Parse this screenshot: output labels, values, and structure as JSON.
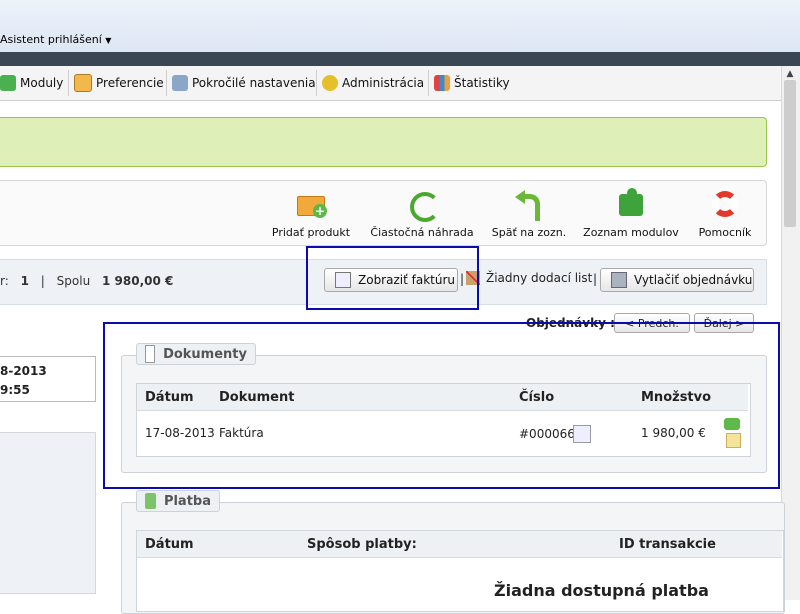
{
  "header": {
    "assistant_label": "Asistent prihlášení"
  },
  "menu": [
    {
      "label": "Moduly",
      "icon": "puzzle-icon"
    },
    {
      "label": "Preferencie",
      "icon": "preferences-icon"
    },
    {
      "label": "Pokročilé nastavenia",
      "icon": "wrench-icon"
    },
    {
      "label": "Administrácia",
      "icon": "key-icon"
    },
    {
      "label": "Štatistiky",
      "icon": "chart-icon"
    }
  ],
  "toolbar": [
    {
      "label": "Pridať produkt",
      "icon": "add-product-icon"
    },
    {
      "label": "Čiastočná náhrada",
      "icon": "refund-icon"
    },
    {
      "label": "Späť na zozn.",
      "icon": "back-icon"
    },
    {
      "label": "Zoznam modulov",
      "icon": "modules-list-icon"
    },
    {
      "label": "Pomocník",
      "icon": "help-icon"
    }
  ],
  "info": {
    "count_label": "r:",
    "count_value": "1",
    "separator": "|",
    "total_label": "Spolu",
    "total_value": "1 980,00 €"
  },
  "actions": {
    "view_invoice": "Zobraziť faktúru",
    "no_delivery": "Žiadny dodací list",
    "print_order": "Vytlačiť objednávku",
    "sep": "|"
  },
  "nav": {
    "label": "Objednávky :",
    "prev": "< Predch.",
    "next": "Ďalej >"
  },
  "left": {
    "date_partial": "8-2013",
    "time_partial": "9:55"
  },
  "documents": {
    "title": "Dokumenty",
    "columns": [
      "Dátum",
      "Dokument",
      "Číslo",
      "Množstvo"
    ],
    "rows": [
      {
        "date": "17-08-2013",
        "document": "Faktúra",
        "number": "#000066",
        "amount": "1 980,00 €"
      }
    ]
  },
  "payment": {
    "title": "Platba",
    "columns": [
      "Dátum",
      "Spôsob platby:",
      "ID transakcie"
    ],
    "empty": "Žiadna dostupná platba"
  },
  "colors": {
    "highlight": "#0b0bb0",
    "alert_bg": "#def0b8",
    "alert_border": "#9ac34c"
  }
}
